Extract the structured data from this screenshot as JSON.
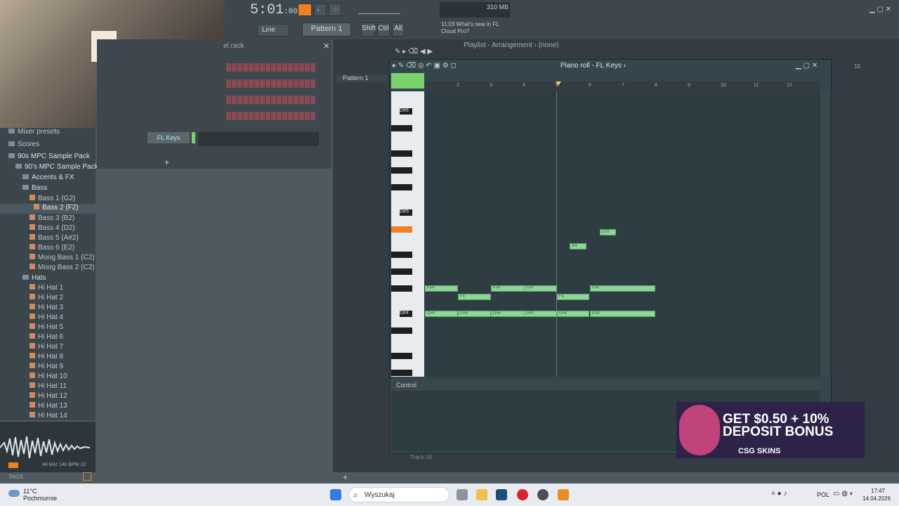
{
  "transport": {
    "time": "5:01",
    "time_small": ":00",
    "mem": "310 MB",
    "pattern": "Pattern 1",
    "snap": "Line"
  },
  "toolbar": {
    "shift": "Shift",
    "ctrl": "Ctrl",
    "alt": "Alt",
    "news_time": "11:03",
    "news": "What's new in FL",
    "news2": "Cloud Pro?"
  },
  "channel_rack": {
    "title": "el rack",
    "channel": "FL Keys"
  },
  "browser": {
    "items": [
      "Mixer presets",
      "Scores",
      "90s MPC Sample Pack",
      "90's MPC Sample Pack",
      "Accents & FX",
      "Bass",
      "Bass 1 (G2)",
      "Bass 2 (F2)",
      "Bass 3 (B2)",
      "Bass 4 (D2)",
      "Bass 5 (A#2)",
      "Bass 6 (E2)",
      "Moog Bass 1 (C2)",
      "Moog Bass 2 (C2)",
      "Hats",
      "Hi Hat 1",
      "Hi Hat 2",
      "Hi Hat 3",
      "Hi Hat 4",
      "Hi Hat 5",
      "Hi Hat 6",
      "Hi Hat 7",
      "Hi Hat 8",
      "Hi Hat 9",
      "Hi Hat 10",
      "Hi Hat 11",
      "Hi Hat 12",
      "Hi Hat 13",
      "Hi Hat 14"
    ],
    "wave_info": "48 kHz 140 BPM 32",
    "tags": "TAGS"
  },
  "playlist": {
    "title": "Playlist - Arrangement",
    "sub": "(none)",
    "pattern_item": "Pattern 1",
    "track18": "Track 18",
    "bar15": "15"
  },
  "piano_roll": {
    "title": "Piano roll - FL Keys",
    "control": "Control",
    "keys": [
      "D#6",
      "D#5",
      "D#4"
    ],
    "bars": [
      "2",
      "3",
      "4",
      "5",
      "6",
      "7",
      "8",
      "9",
      "10",
      "11",
      "12"
    ]
  },
  "notes": [
    {
      "label": "F#4",
      "row": "f#4",
      "bar": 1.0,
      "len": 1.0
    },
    {
      "label": "F4",
      "row": "f4",
      "bar": 2.0,
      "len": 1.0
    },
    {
      "label": "F#4",
      "row": "f#4",
      "bar": 3.0,
      "len": 2.0
    },
    {
      "label": "F#4",
      "row": "f#4",
      "bar": 4.0,
      "len": 1.0
    },
    {
      "label": "F4",
      "row": "f4",
      "bar": 5.0,
      "len": 1.0
    },
    {
      "label": "F#4",
      "row": "f#4",
      "bar": 6.0,
      "len": 2.0
    },
    {
      "label": "D#4",
      "row": "d#4",
      "bar": 1.0,
      "len": 1.0
    },
    {
      "label": "D#4",
      "row": "d#4",
      "bar": 2.0,
      "len": 1.0
    },
    {
      "label": "D#4",
      "row": "d#4",
      "bar": 3.0,
      "len": 2.0
    },
    {
      "label": "D#4",
      "row": "d#4",
      "bar": 4.0,
      "len": 1.0
    },
    {
      "label": "D#4",
      "row": "d#4",
      "bar": 5.0,
      "len": 1.0
    },
    {
      "label": "D#4",
      "row": "d#4",
      "bar": 6.0,
      "len": 2.0
    },
    {
      "label": "B4",
      "row": "b4",
      "bar": 5.4,
      "len": 0.5
    },
    {
      "label": "C#5",
      "row": "c#5",
      "bar": 6.3,
      "len": 0.5
    }
  ],
  "ad": {
    "line1": "GET $0.50 + 10%",
    "line2": "DEPOSIT BONUS",
    "brand": "CSG SKINS"
  },
  "taskbar": {
    "temp": "11°C",
    "weather": "Pochmurnie",
    "search": "Wyszukaj",
    "lang": "POL",
    "clock": "17:47",
    "date": "14.04.2026"
  },
  "colors": {
    "note": "#8fd49a",
    "accent": "#f08020"
  }
}
